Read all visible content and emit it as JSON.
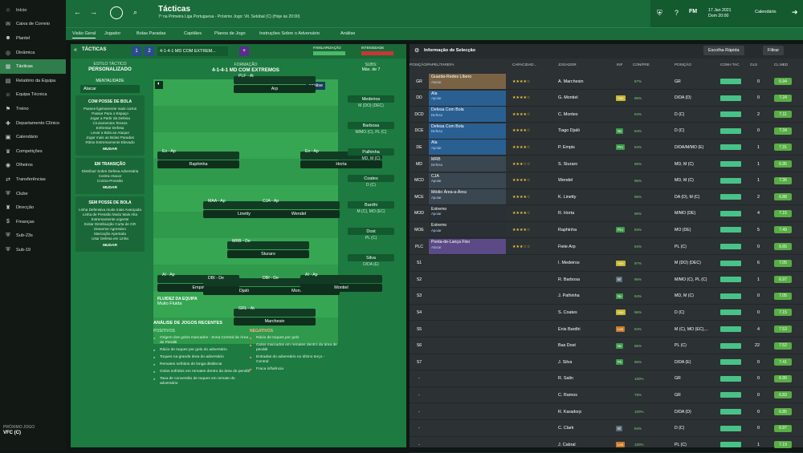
{
  "sidebar": {
    "items": [
      {
        "label": "Início",
        "icon": "home-icon"
      },
      {
        "label": "Caixa de Correio",
        "icon": "mail-icon"
      },
      {
        "label": "Plantel",
        "icon": "people-icon"
      },
      {
        "label": "Dinâmica",
        "icon": "dynamics-icon"
      },
      {
        "label": "Tácticas",
        "icon": "tactics-icon",
        "active": true
      },
      {
        "label": "Relatório da Equipa",
        "icon": "report-icon"
      },
      {
        "label": "Equipa Técnica",
        "icon": "staff-icon"
      },
      {
        "label": "Treino",
        "icon": "training-icon"
      },
      {
        "label": "Departamento Clínico",
        "icon": "medical-icon"
      },
      {
        "label": "Calendário",
        "icon": "calendar-icon"
      },
      {
        "label": "Competições",
        "icon": "trophy-icon"
      },
      {
        "label": "Olheiros",
        "icon": "scout-icon"
      },
      {
        "label": "Transferências",
        "icon": "transfer-icon"
      },
      {
        "label": "Clube",
        "icon": "club-icon"
      },
      {
        "label": "Direcção",
        "icon": "board-icon"
      },
      {
        "label": "Finanças",
        "icon": "finance-icon"
      },
      {
        "label": "Sub-23s",
        "icon": "u23-icon"
      },
      {
        "label": "Sub-19",
        "icon": "u19-icon"
      }
    ],
    "next_game_label": "PRÓXIMO JOGO",
    "next_game_value": "VFC (C)"
  },
  "header": {
    "title": "Tácticas",
    "subtitle": "7º na Primeira Liga Portuguesa - Próximo Jogo: Vit. Setúbal (C) (Hoje às 20:00)",
    "brand": "FM",
    "date_line1": "17 Jan 2021",
    "date_line2": "Dom 20:00",
    "calendar_label": "Calendário"
  },
  "nav": [
    "Visão Geral",
    "Jogador",
    "Bolas Paradas",
    "Capitães",
    "Planos de Jogo",
    "Instruções Sobre o Adversário",
    "Análise"
  ],
  "tactics": {
    "tab_label": "TÁCTICAS",
    "tactic_num_1": "1",
    "tactic_num_2": "2",
    "tactic_name": "4-1-4-1 MD COM EXTREM...",
    "familiarity_label": "FAMILIARIZAÇÃO",
    "intensity_label": "INTENSIDADE",
    "style_label": "ESTILO TÁCTICO",
    "style_value": "PERSONALIZADO",
    "formation_label": "FORMAÇÃO",
    "formation_value": "4-1-4-1 MD COM EXTREMOS",
    "subs_label": "SUBS:",
    "subs_max": "Máx. de 7",
    "analysis_btn": "Análise",
    "mentality_label": "MENTALIDADE",
    "mentality_value": "Atacar",
    "with_ball_title": "COM POSSE DE BOLA",
    "with_ball_items": [
      "Passes ligeiramente mais curtos",
      "Passar Para o Espaço",
      "Jogar a Partir da Defesa",
      "Cruzamentos Tensos",
      "Enfrentar Defesa",
      "Levar a Bola ao Ataque",
      "Jogar mais as Bolas Paradas",
      "Ritmo Extremamente Elevado"
    ],
    "transition_title": "EM TRANSIÇÃO",
    "transition_items": [
      "Distribuir Sobre Defesa Adversária",
      "Contra-Atacar",
      "Contra-Pressão"
    ],
    "without_ball_title": "SEM POSSE DE BOLA",
    "without_ball_items": [
      "Linha Defensiva muito mais Avançada",
      "Linha de Pressão Muito Mais Alta",
      "Extremamente urgente",
      "Evitar Distribuição Curta de GR",
      "Desarme Agressivo",
      "Marcação Apertada",
      "Usar Defesa em Linha"
    ],
    "change_label": "MUDAR",
    "fluidity_label": "FLUIDEZ DA EQUIPA",
    "fluidity_value": "Muito Fluida",
    "analysis_title": "ANÁLISE DE JOGOS RECENTES",
    "positives_label": "POSITIVOS",
    "positives": [
      "Origem dos golos marcados - Zona Central da Área de Penálti",
      "Rácio de toques por golo do adversário",
      "Toques na grande área do adversário",
      "Remates sofridos de longa distância",
      "Golos sofridos em remates dentro da área de penálti",
      "Taxa de conversão de toques em remate do adversário"
    ],
    "negatives_label": "NEGATIVOS",
    "negatives": [
      "Rácio de toques por golo",
      "Golos marcados em remates dentro da área de penálti",
      "Entradas do adversário no último terço - Central",
      "Fraca influência"
    ],
    "players": [
      {
        "role": "PLF - At",
        "name": "Arp"
      },
      {
        "role": "Ex - Ap",
        "name": "Raphinha"
      },
      {
        "role": "Ex - Ap",
        "name": "Horta"
      },
      {
        "role": "MAA - Ap",
        "name": "Linetty"
      },
      {
        "role": "CJA - Ap",
        "name": "Wendel"
      },
      {
        "role": "MRB - De",
        "name": "Sturaro"
      },
      {
        "role": "AI - Ap",
        "name": "Empis"
      },
      {
        "role": "DBI - De",
        "name": "Djaló"
      },
      {
        "role": "DBI - De",
        "name": "Montes"
      },
      {
        "role": "AI - Ap",
        "name": "Montiel"
      },
      {
        "role": "GRL - At",
        "name": "Marchesin"
      }
    ],
    "subs": [
      {
        "name": "Medeiros",
        "pos": "M (DO) (DEC)"
      },
      {
        "name": "Barbosa",
        "pos": "M/MO (C), PL (C)"
      },
      {
        "name": "Palhinha",
        "pos": "MD, M (C)"
      },
      {
        "name": "Coates",
        "pos": "D (C)"
      },
      {
        "name": "Bardhi",
        "pos": "M (C), MO (EC)"
      },
      {
        "name": "Dost",
        "pos": "PL (C)"
      },
      {
        "name": "Silva",
        "pos": "D/DA (E)"
      }
    ]
  },
  "selection": {
    "title": "Informação de Selecção",
    "quick_pick": "Escolha Rápida",
    "filter": "Filtrar",
    "columns": [
      "POSIÇÃO/PAPEL/TAREFA",
      "CAPACIDAD...",
      "JOGADOR",
      "INF",
      "CON/FRE",
      "POSIÇÃO",
      "CONH TAC",
      "GLS",
      "CL MED"
    ],
    "rows": [
      {
        "pos": "GR",
        "role": "Guarda-Redes Líbero",
        "duty": "Atacar",
        "stars": "★★★★☆",
        "player": "A. Marchesin",
        "inf": "",
        "cond": "97%",
        "position": "GR",
        "gls": "0",
        "med": "6.94"
      },
      {
        "pos": "DD",
        "role": "Ala",
        "duty": "Apoiar",
        "stars": "★★★★☆",
        "player": "G. Montiel",
        "inf": "Aav",
        "cond": "96%",
        "position": "D/DA (D)",
        "gls": "0",
        "med": "7.24"
      },
      {
        "pos": "DCD",
        "role": "Defesa Com Bola",
        "duty": "Defesa",
        "stars": "★★★★☆",
        "player": "C. Montes",
        "inf": "",
        "cond": "94%",
        "position": "D (C)",
        "gls": "2",
        "med": "7.11"
      },
      {
        "pos": "DCE",
        "role": "Defesa Com Bola",
        "duty": "Defesa",
        "stars": "★★★★☆",
        "player": "Tiago Djaló",
        "inf": "Nv",
        "cond": "94%",
        "position": "D (C)",
        "gls": "0",
        "med": "7.34"
      },
      {
        "pos": "DE",
        "role": "Ala",
        "duty": "Apoiar",
        "stars": "★★★★☆",
        "player": "P. Empis",
        "inf": "Pro",
        "cond": "94%",
        "position": "D/DA/M/MO (E)",
        "gls": "1",
        "med": "7.31"
      },
      {
        "pos": "MD",
        "role": "MRB",
        "duty": "Defesa",
        "stars": "★★★☆☆",
        "player": "S. Sturaro",
        "inf": "",
        "cond": "96%",
        "position": "MD, M (C)",
        "gls": "1",
        "med": "6.95"
      },
      {
        "pos": "MCD",
        "role": "CJA",
        "duty": "Apoiar",
        "stars": "★★★★☆",
        "player": "Wendel",
        "inf": "",
        "cond": "96%",
        "position": "MD, M (C)",
        "gls": "1",
        "med": "7.36"
      },
      {
        "pos": "MCE",
        "role": "Médio Área-a-Área",
        "duty": "Apoiar",
        "stars": "★★★★☆",
        "player": "K. Linetty",
        "inf": "",
        "cond": "96%",
        "position": "DA (D), M (C)",
        "gls": "2",
        "med": "6.88"
      },
      {
        "pos": "MOD",
        "role": "Extremo",
        "duty": "Apoiar",
        "stars": "★★★★☆",
        "player": "R. Horta",
        "inf": "",
        "cond": "96%",
        "position": "M/MO (DE)",
        "gls": "4",
        "med": "7.15"
      },
      {
        "pos": "MOE",
        "role": "Extremo",
        "duty": "Apoiar",
        "stars": "★★★★☆",
        "player": "Raphinha",
        "inf": "Pro",
        "cond": "93%",
        "position": "MO (DE)",
        "gls": "5",
        "med": "7.49"
      },
      {
        "pos": "PLC",
        "role": "Ponta-de-Lança Fixo",
        "duty": "Atacar",
        "stars": "★★★☆☆",
        "player": "Fiete Arp",
        "inf": "",
        "cond": "94%",
        "position": "PL (C)",
        "gls": "0",
        "med": "6.65"
      },
      {
        "pos": "S1",
        "role": "",
        "duty": "",
        "stars": "",
        "player": "I. Medeiros",
        "inf": "Aav",
        "cond": "97%",
        "position": "M (DO) (DEC)",
        "gls": "6",
        "med": "7.05"
      },
      {
        "pos": "S2",
        "role": "",
        "duty": "",
        "stars": "",
        "player": "R. Barbosa",
        "inf": "Bl",
        "cond": "96%",
        "position": "M/MO (C), PL (C)",
        "gls": "1",
        "med": "6.97"
      },
      {
        "pos": "S3",
        "role": "",
        "duty": "",
        "stars": "",
        "player": "J. Palhinha",
        "inf": "Nv",
        "cond": "94%",
        "position": "MD, M (C)",
        "gls": "0",
        "med": "7.05"
      },
      {
        "pos": "S4",
        "role": "",
        "duty": "",
        "stars": "",
        "player": "S. Coates",
        "inf": "Aav",
        "cond": "96%",
        "position": "D (C)",
        "gls": "0",
        "med": "7.15"
      },
      {
        "pos": "S5",
        "role": "",
        "duty": "",
        "stars": "",
        "player": "Enis Bardhi",
        "inf": "Les",
        "cond": "94%",
        "position": "M (C), MO (EC),...",
        "gls": "4",
        "med": "7.53"
      },
      {
        "pos": "S6",
        "role": "",
        "duty": "",
        "stars": "",
        "player": "Bas Dost",
        "inf": "Nv",
        "cond": "96%",
        "position": "PL (C)",
        "gls": "22",
        "med": "7.52"
      },
      {
        "pos": "S7",
        "role": "",
        "duty": "",
        "stars": "",
        "player": "J. Silva",
        "inf": "Pri",
        "cond": "96%",
        "position": "D/DA (E)",
        "gls": "0",
        "med": "7.41"
      },
      {
        "pos": "-",
        "role": "",
        "duty": "",
        "stars": "",
        "player": "R. Salin",
        "inf": "",
        "cond": "100%",
        "position": "GR",
        "gls": "0",
        "med": "6.90"
      },
      {
        "pos": "-",
        "role": "",
        "duty": "",
        "stars": "",
        "player": "C. Ramos",
        "inf": "",
        "cond": "78%",
        "position": "GR",
        "gls": "0",
        "med": "6.83"
      },
      {
        "pos": "-",
        "role": "",
        "duty": "",
        "stars": "",
        "player": "R. Karadorp",
        "inf": "",
        "cond": "100%",
        "position": "D/DA (D)",
        "gls": "0",
        "med": "6.85"
      },
      {
        "pos": "-",
        "role": "",
        "duty": "",
        "stars": "",
        "player": "C. Clark",
        "inf": "Bl",
        "cond": "94%",
        "position": "D (C)",
        "gls": "0",
        "med": "6.97"
      },
      {
        "pos": "-",
        "role": "",
        "duty": "",
        "stars": "",
        "player": "J. Cabral",
        "inf": "Les",
        "cond": "100%",
        "position": "PL (C)",
        "gls": "1",
        "med": "7.19"
      }
    ]
  }
}
